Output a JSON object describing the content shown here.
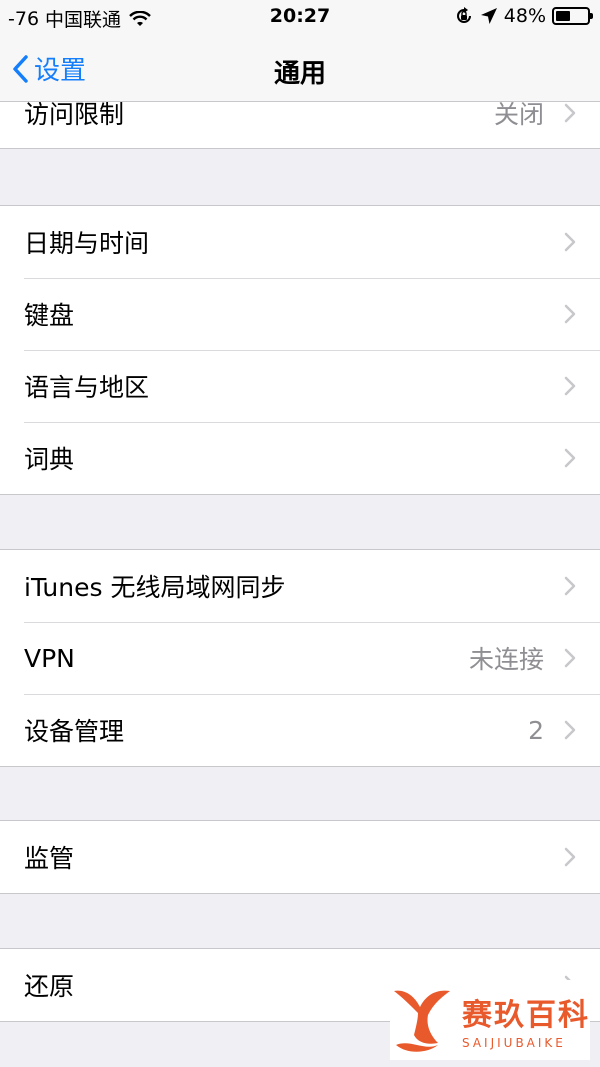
{
  "status_bar": {
    "signal": "-76",
    "carrier": "中国联通",
    "time": "20:27",
    "battery": "48%",
    "battery_level": 0.48,
    "icons": [
      "wifi-icon",
      "rotation-lock-icon",
      "location-arrow-icon",
      "battery-icon"
    ]
  },
  "nav": {
    "back_label": "设置",
    "title": "通用"
  },
  "groups": [
    {
      "rows": [
        {
          "label": "访问限制",
          "detail": "关闭"
        }
      ]
    },
    {
      "rows": [
        {
          "label": "日期与时间",
          "detail": ""
        },
        {
          "label": "键盘",
          "detail": ""
        },
        {
          "label": "语言与地区",
          "detail": ""
        },
        {
          "label": "词典",
          "detail": ""
        }
      ]
    },
    {
      "rows": [
        {
          "label": "iTunes 无线局域网同步",
          "detail": ""
        },
        {
          "label": "VPN",
          "detail": "未连接"
        },
        {
          "label": "设备管理",
          "detail": "2"
        }
      ]
    },
    {
      "rows": [
        {
          "label": "监管",
          "detail": ""
        }
      ]
    },
    {
      "rows": [
        {
          "label": "还原",
          "detail": ""
        }
      ]
    }
  ],
  "watermark": {
    "main": "赛玖百科",
    "sub": "SAIJIUBAIKE",
    "color": "#e85a2c"
  },
  "colors": {
    "accent": "#147efb",
    "background": "#efeff4",
    "secondary_text": "#8e8e93",
    "chevron": "#c7c7cc"
  }
}
